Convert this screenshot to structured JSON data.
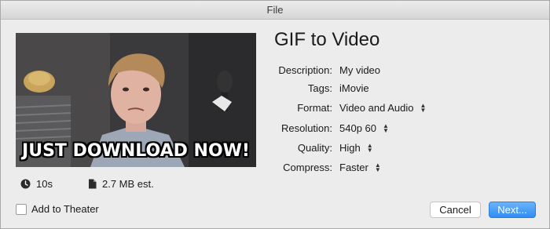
{
  "window": {
    "title": "File"
  },
  "preview": {
    "caption": "JUST DOWNLOAD NOW!",
    "duration": "10s",
    "size": "2.7 MB est."
  },
  "dialog": {
    "title": "GIF to Video",
    "fields": [
      {
        "label": "Description:",
        "value": "My video",
        "stepper": false
      },
      {
        "label": "Tags:",
        "value": "iMovie",
        "stepper": false
      },
      {
        "label": "Format:",
        "value": "Video and Audio",
        "stepper": true
      },
      {
        "label": "Resolution:",
        "value": "540p 60",
        "stepper": true
      },
      {
        "label": "Quality:",
        "value": "High",
        "stepper": true
      },
      {
        "label": "Compress:",
        "value": "Faster",
        "stepper": true
      }
    ]
  },
  "footer": {
    "theater_label": "Add to Theater",
    "theater_checked": false,
    "cancel_label": "Cancel",
    "next_label": "Next..."
  },
  "icons": {
    "duration": "clock-icon",
    "size": "document-icon",
    "stepper": "up-down-chevron-icon"
  },
  "colors": {
    "accent": "#3b91f4",
    "window_bg": "#ececec"
  }
}
